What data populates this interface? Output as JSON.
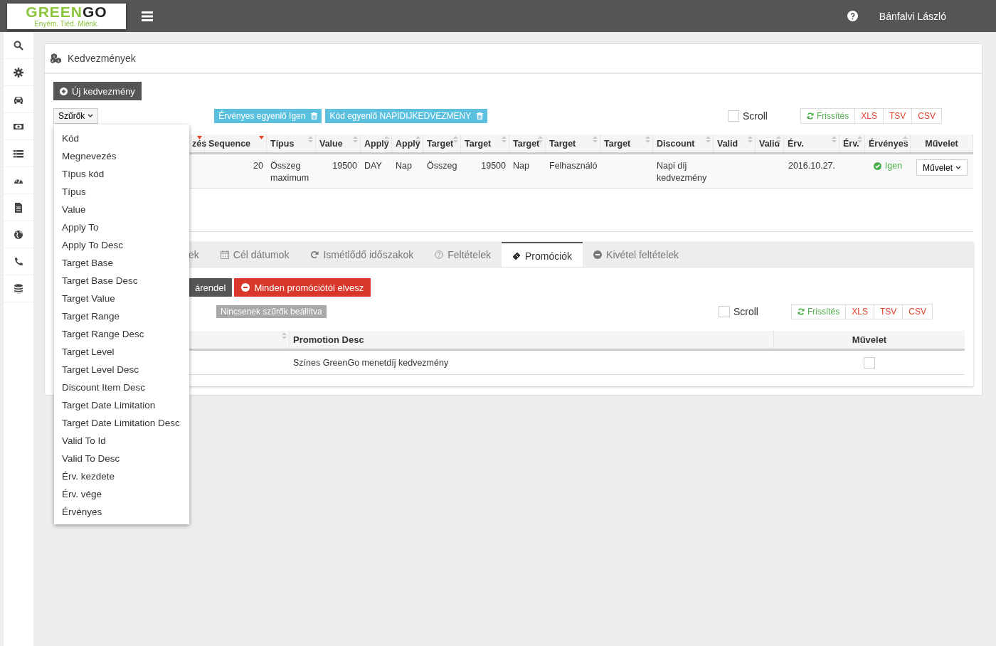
{
  "header": {
    "logo_start": "GREEN",
    "logo_end": "GO",
    "tagline": "Enyém. Tiéd. Miénk.",
    "user": "Bánfalvi László"
  },
  "panel": {
    "title": "Kedvezmények",
    "new_button": "Új kedvezmény",
    "filter_button": "Szűrők",
    "chips": [
      "Érvényes egyenlő Igen",
      "Kód egyenlő NAPIDIJKEDVEZMENY"
    ],
    "scroll": {
      "label": "Scroll",
      "checked": false
    },
    "exports": [
      "Frissítés",
      "XLS",
      "TSV",
      "CSV"
    ],
    "table": {
      "columns": [
        {
          "label": "zés",
          "kind": "sortable",
          "sorted": true
        },
        {
          "label": "Sequence",
          "kind": "sortable",
          "sorted": true
        },
        {
          "label": "Típus",
          "kind": "sortable",
          "sorted": false
        },
        {
          "label": "Value",
          "kind": "sortable",
          "sorted": false
        },
        {
          "label": "Apply",
          "kind": "sortable",
          "sorted": false
        },
        {
          "label": "Apply",
          "kind": "sortable",
          "sorted": false
        },
        {
          "label": "Target",
          "kind": "sortable",
          "sorted": false
        },
        {
          "label": "Target",
          "kind": "sortable",
          "sorted": false
        },
        {
          "label": "Target",
          "kind": "sortable",
          "sorted": false
        },
        {
          "label": "Target",
          "kind": "sortable",
          "sorted": false
        },
        {
          "label": "Target",
          "kind": "sortable",
          "sorted": false
        },
        {
          "label": "Discount",
          "kind": "sortable",
          "sorted": false
        },
        {
          "label": "Valid",
          "kind": "sortable",
          "sorted": false
        },
        {
          "label": "Valid",
          "kind": "sortable",
          "sorted": false
        },
        {
          "label": "Érv.",
          "kind": "sortable",
          "sorted": false
        },
        {
          "label": "Érv.",
          "kind": "sortable",
          "sorted": false
        },
        {
          "label": "Érvényes",
          "kind": "sortable",
          "sorted": false
        },
        {
          "label": "Művelet",
          "kind": "plain",
          "sorted": false
        }
      ],
      "rows": [
        {
          "cells": [
            {
              "kind": "empty"
            },
            {
              "kind": "number",
              "text": "20"
            },
            {
              "kind": "text",
              "text": "Összeg maximum"
            },
            {
              "kind": "number",
              "text": "19500"
            },
            {
              "kind": "text",
              "text": "DAY"
            },
            {
              "kind": "text",
              "text": "Nap"
            },
            {
              "kind": "text",
              "text": "Összeg"
            },
            {
              "kind": "number",
              "text": "19500"
            },
            {
              "kind": "text",
              "text": "Nap"
            },
            {
              "kind": "text",
              "text": "Felhasználó"
            },
            {
              "kind": "empty"
            },
            {
              "kind": "text",
              "text": "Napi díj kedvezmény"
            },
            {
              "kind": "empty"
            },
            {
              "kind": "empty"
            },
            {
              "kind": "date",
              "text": "2016.10.27."
            },
            {
              "kind": "empty"
            },
            {
              "kind": "status",
              "text": "Igen"
            },
            {
              "kind": "action",
              "text": "Művelet"
            }
          ]
        }
      ]
    }
  },
  "filter_menu": {
    "items": [
      "Kód",
      "Megnevezés",
      "Típus kód",
      "Típus",
      "Value",
      "Apply To",
      "Apply To Desc",
      "Target Base",
      "Target Base Desc",
      "Target Value",
      "Target Range",
      "Target Range Desc",
      "Target Level",
      "Target Level Desc",
      "Discount Item Desc",
      "Target Date Limitation",
      "Target Date Limitation Desc",
      "Valid To Id",
      "Valid To Desc",
      "Érv. kezdete",
      "Érv. vége",
      "Érvényes"
    ]
  },
  "detail": {
    "tabs": [
      {
        "label": "ek",
        "selected": false
      },
      {
        "label": "Cél dátumok",
        "selected": false
      },
      {
        "label": "Ismétlődő időszakok",
        "selected": false
      },
      {
        "label": "Feltételek",
        "selected": false
      },
      {
        "label": "Promóciók",
        "selected": true
      },
      {
        "label": "Kivétel feltételek",
        "selected": false
      }
    ],
    "assign_button": "árendel",
    "remove_all_button": "Minden promóciótól elvesz",
    "no_filters": "Nincsenek szűrők beállítva",
    "scroll": {
      "label": "Scroll",
      "checked": false
    },
    "exports": [
      "Frissítés",
      "XLS",
      "TSV",
      "CSV"
    ],
    "table": {
      "columns": [
        {
          "sortable": true
        },
        {
          "label": "Promotion Desc",
          "sortable": false
        },
        {
          "label": "Művelet",
          "sortable": false
        }
      ],
      "rows": [
        {
          "cells": [
            {
              "kind": "empty"
            },
            {
              "kind": "text",
              "text": "Színes GreenGo menetdíj kedvezmény"
            }
          ],
          "checked": false
        }
      ]
    }
  }
}
